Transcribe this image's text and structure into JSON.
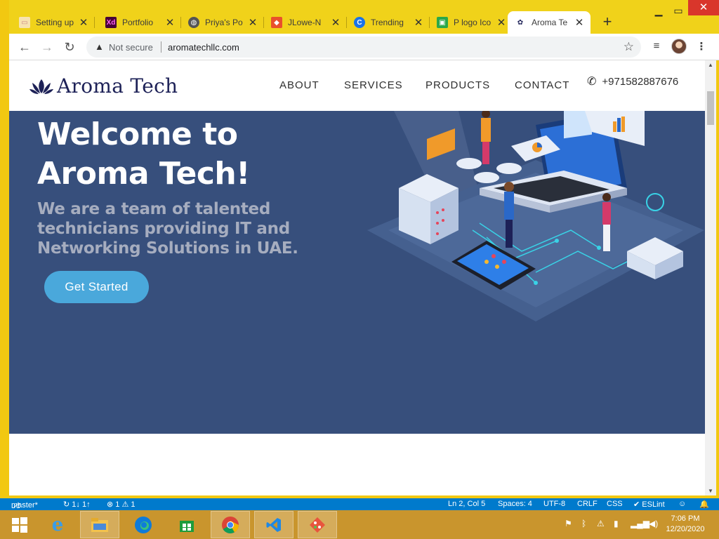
{
  "browser": {
    "tabs": [
      {
        "title": "Setting up",
        "icon": "generic-page-icon"
      },
      {
        "title": "Portfolio",
        "icon": "adobe-xd-icon"
      },
      {
        "title": "Priya's Po",
        "icon": "globe-icon"
      },
      {
        "title": "JLowe-N",
        "icon": "codepen-icon"
      },
      {
        "title": "Trending",
        "icon": "trending-icon"
      },
      {
        "title": "P logo Ico",
        "icon": "green-square-icon"
      },
      {
        "title": "Aroma Te",
        "icon": "aroma-lotus-icon",
        "active": true
      }
    ],
    "security_label": "Not secure",
    "url": "aromatechllc.com"
  },
  "site": {
    "brand": "Aroma Tech",
    "nav": [
      "ABOUT",
      "SERVICES",
      "PRODUCTS",
      "CONTACT"
    ],
    "phone": "+971582887676",
    "hero": {
      "title_line1": "Welcome to",
      "title_line2": "Aroma Tech!",
      "subtitle": "We are a team of talented technicians providing IT and Networking Solutions in UAE.",
      "cta": "Get Started"
    }
  },
  "statusbar": {
    "branch": "master*",
    "sync": "↻ 1↓ 1↑",
    "problems": "⊗ 1 ⚠ 1",
    "position": "Ln 2, Col 5",
    "spaces": "Spaces: 4",
    "encoding": "UTF-8",
    "eol": "CRLF",
    "language": "CSS",
    "linter": "✔ ESLint"
  },
  "taskbar": {
    "time": "7:06 PM",
    "date": "12/20/2020"
  },
  "colors": {
    "hero_bg": "#374f7c",
    "cta": "#4aa8db",
    "brand": "#1d2157",
    "chrome_frame": "#f0d21a",
    "taskbar": "#c9952d",
    "statusbar": "#007acc"
  }
}
